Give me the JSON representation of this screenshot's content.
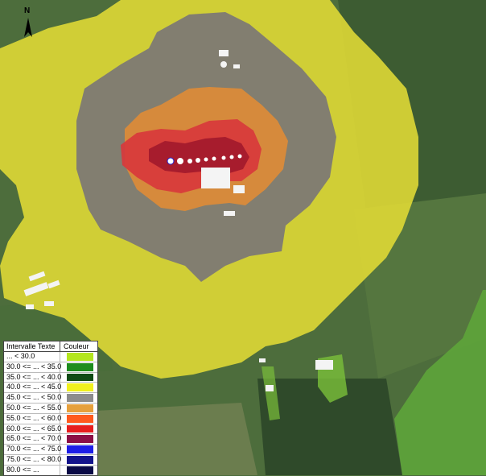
{
  "map": {
    "north_label": "N",
    "colors": {
      "field_dark": "#3f5f33",
      "field_mid": "#5a7a45",
      "field_light": "#7b9a5a",
      "yellow": "#e6dd3a",
      "gray": "#7a7674",
      "orange": "#d98a3a",
      "red": "#d23a3a",
      "dark_red": "#a0182a",
      "green_bright": "#5fa83a"
    }
  },
  "legend": {
    "header_interval": "Intervalle Texte",
    "header_color": "Couleur",
    "rows": [
      {
        "label": "... < 30.0",
        "color": "#b4e61e"
      },
      {
        "label": "30.0 <= ... < 35.0",
        "color": "#1e8c1e"
      },
      {
        "label": "35.0 <= ... < 40.0",
        "color": "#0f4a14"
      },
      {
        "label": "40.0 <= ... < 45.0",
        "color": "#f0f01e"
      },
      {
        "label": "45.0 <= ... < 50.0",
        "color": "#8c8c8c"
      },
      {
        "label": "50.0 <= ... < 55.0",
        "color": "#e6a03c"
      },
      {
        "label": "55.0 <= ... < 60.0",
        "color": "#ff5a1e"
      },
      {
        "label": "60.0 <= ... < 65.0",
        "color": "#e61e1e"
      },
      {
        "label": "65.0 <= ... < 70.0",
        "color": "#8c0f46"
      },
      {
        "label": "70.0 <= ... < 75.0",
        "color": "#1e1ee6"
      },
      {
        "label": "75.0 <= ... < 80.0",
        "color": "#14148c"
      },
      {
        "label": "80.0 <= ...",
        "color": "#0a0a46"
      }
    ]
  }
}
